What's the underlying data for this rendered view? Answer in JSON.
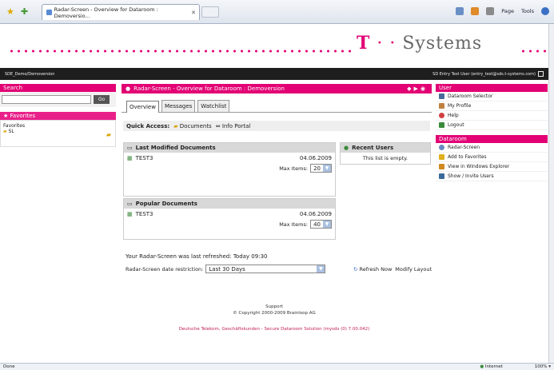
{
  "browser": {
    "tab_title": "Radar-Screen - Overview for Dataroom : Demoversio...",
    "tools": [
      "Page",
      "Tools"
    ]
  },
  "brand": {
    "logo_t": "T",
    "logo_rest": "Systems",
    "accent": "#e20074"
  },
  "strip": {
    "left": "SDE_Demo/Demoversion",
    "right": "SD Entry Test User (entry_test@sds.t-systems.com)"
  },
  "left": {
    "search_title": "Search",
    "go_label": "Go",
    "favorites_title": "Favorites",
    "favorites_label": "Favorites",
    "favorite_item": "SL"
  },
  "main": {
    "title": "Radar-Screen - Overview for Dataroom : Demoversion",
    "tabs": [
      "Overview",
      "Messages",
      "Watchlist"
    ],
    "quick_access_label": "Quick Access:",
    "quick_links": [
      "Documents",
      "Info Portal"
    ],
    "last_modified": {
      "title": "Last Modified Documents",
      "doc": "TEST3",
      "date": "04.06.2009",
      "max_label": "Max Items:",
      "max_value": "20"
    },
    "recent_users": {
      "title": "Recent Users",
      "empty": "This list is empty."
    },
    "popular": {
      "title": "Popular Documents",
      "doc": "TEST3",
      "date": "04.06.2009",
      "max_label": "Max Items:",
      "max_value": "40"
    },
    "refreshed": "Your Radar-Screen was last refreshed: Today 09:30",
    "date_restriction_label": "Radar-Screen date restriction:",
    "date_restriction_value": "Last 30 Days",
    "refresh_now": "Refresh Now",
    "modify_layout": "Modify Layout"
  },
  "right": {
    "user_title": "User",
    "user_items": [
      "Dataroom Selector",
      "My Profile",
      "Help",
      "Logout"
    ],
    "dataroom_title": "Dataroom",
    "dataroom_items": [
      "Radar-Screen",
      "Add to Favorites",
      "View in Windows Explorer",
      "Show / Invite Users"
    ]
  },
  "footer": {
    "support": "Support",
    "copyright": "© Copyright 2000-2009 Brainloop AG",
    "legal": "Deutsche Telekom, Geschäftskunden - Secure Dataroom Solution (mysds (0) 7.00.042)"
  },
  "status": {
    "left": "Done",
    "zone": "Internet",
    "zoom": "100%"
  }
}
